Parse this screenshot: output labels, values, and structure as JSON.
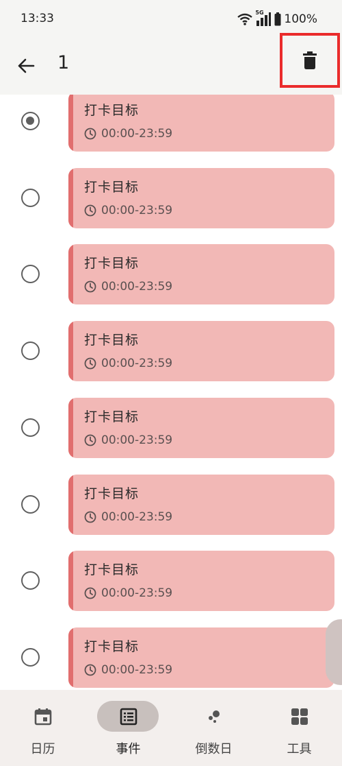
{
  "status_bar": {
    "time": "13:33",
    "network_type": "5G",
    "battery": "100%"
  },
  "app_bar": {
    "selected_count": "1",
    "back_icon": "arrow-left-icon",
    "delete_icon": "trash-icon",
    "highlight_color": "#ea2b2b"
  },
  "events": [
    {
      "title": "打卡目标",
      "time": "00:00-23:59",
      "selected": true
    },
    {
      "title": "打卡目标",
      "time": "00:00-23:59",
      "selected": false
    },
    {
      "title": "打卡目标",
      "time": "00:00-23:59",
      "selected": false
    },
    {
      "title": "打卡目标",
      "time": "00:00-23:59",
      "selected": false
    },
    {
      "title": "打卡目标",
      "time": "00:00-23:59",
      "selected": false
    },
    {
      "title": "打卡目标",
      "time": "00:00-23:59",
      "selected": false
    },
    {
      "title": "打卡目标",
      "time": "00:00-23:59",
      "selected": false
    },
    {
      "title": "打卡目标",
      "time": "00:00-23:59",
      "selected": false
    }
  ],
  "colors": {
    "card_background": "#f2b8b6",
    "card_accent": "#e16e6e",
    "active_nav_pill": "#c8c0bd"
  },
  "bottom_nav": {
    "items": [
      {
        "label": "日历",
        "icon": "calendar-icon",
        "active": false
      },
      {
        "label": "事件",
        "icon": "list-icon",
        "active": true
      },
      {
        "label": "倒数日",
        "icon": "bubbles-icon",
        "active": false
      },
      {
        "label": "工具",
        "icon": "grid-icon",
        "active": false
      }
    ]
  }
}
